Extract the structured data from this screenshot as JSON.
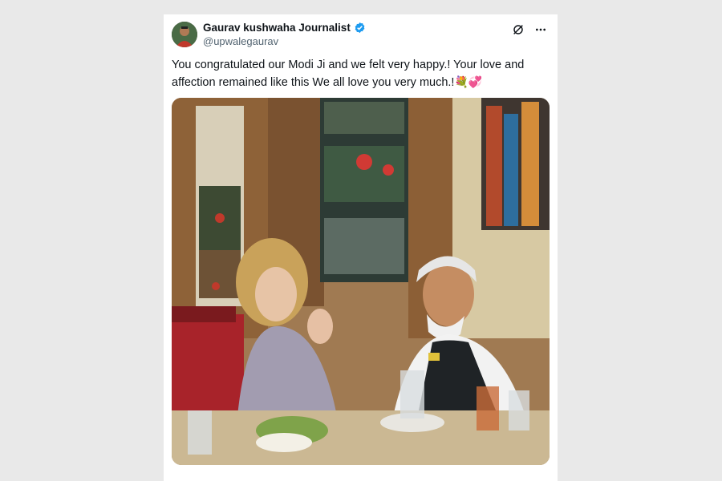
{
  "author": {
    "display_name": "Gaurav kushwaha Journalist",
    "handle": "@upwalegaurav",
    "verified_icon": "verified-badge-icon"
  },
  "tweet": {
    "text": "You congratulated our Modi Ji and we felt very happy.! Your love and affection remained like this We all love you very much.!",
    "emojis": "💐💞"
  },
  "icons": {
    "grok": "grok-icon",
    "more": "more-options-icon"
  },
  "colors": {
    "verified_blue": "#1d9bf0",
    "text_primary": "#0f1419",
    "text_secondary": "#536471"
  }
}
